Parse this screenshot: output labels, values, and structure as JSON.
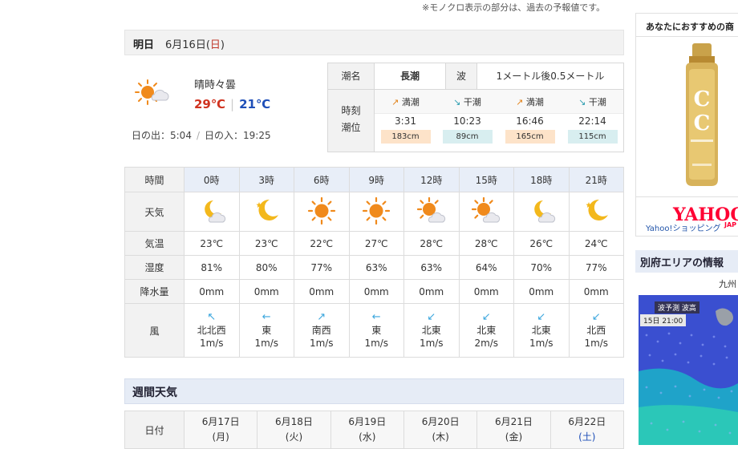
{
  "note": "※モノクロ表示の部分は、過去の予報値です。",
  "day": {
    "label": "明日",
    "date": "6月16日",
    "dow_open": "(",
    "dow": "日",
    "dow_close": ")"
  },
  "summary": {
    "icon": "sun-cloud-icon",
    "telop": "晴時々曇",
    "max": "29℃",
    "min": "21℃",
    "sunrise": "日の出：5:04",
    "sunset": "日の入：19:25"
  },
  "tide": {
    "name_label": "潮名",
    "name": "長潮",
    "wave_label": "波",
    "wave": "1メートル後0.5メートル",
    "row_label_1": "時刻",
    "row_label_2": "潮位",
    "events": [
      {
        "arrow": "↗",
        "type": "満潮",
        "time": "3:31",
        "level": "183cm",
        "kind": "high"
      },
      {
        "arrow": "↘",
        "type": "干潮",
        "time": "10:23",
        "level": "89cm",
        "kind": "low"
      },
      {
        "arrow": "↗",
        "type": "満潮",
        "time": "16:46",
        "level": "165cm",
        "kind": "high"
      },
      {
        "arrow": "↘",
        "type": "干潮",
        "time": "22:14",
        "level": "115cm",
        "kind": "low"
      }
    ]
  },
  "hourly": {
    "labels": {
      "time": "時間",
      "weather": "天気",
      "temp": "気温",
      "humidity": "湿度",
      "precip": "降水量",
      "wind": "風"
    },
    "hours": [
      {
        "time": "0時",
        "icon": "moon-cloud-icon",
        "temp": "23℃",
        "humidity": "81%",
        "precip": "0mm",
        "wind_arrow": "↖",
        "wind_dir": "北北西",
        "wind_speed": "1m/s"
      },
      {
        "time": "3時",
        "icon": "moon-icon",
        "temp": "23℃",
        "humidity": "80%",
        "precip": "0mm",
        "wind_arrow": "←",
        "wind_dir": "東",
        "wind_speed": "1m/s"
      },
      {
        "time": "6時",
        "icon": "sun-icon",
        "temp": "22℃",
        "humidity": "77%",
        "precip": "0mm",
        "wind_arrow": "↗",
        "wind_dir": "南西",
        "wind_speed": "1m/s"
      },
      {
        "time": "9時",
        "icon": "sun-icon",
        "temp": "27℃",
        "humidity": "63%",
        "precip": "0mm",
        "wind_arrow": "←",
        "wind_dir": "東",
        "wind_speed": "1m/s"
      },
      {
        "time": "12時",
        "icon": "sun-cloud-icon",
        "temp": "28℃",
        "humidity": "63%",
        "precip": "0mm",
        "wind_arrow": "↙",
        "wind_dir": "北東",
        "wind_speed": "1m/s"
      },
      {
        "time": "15時",
        "icon": "sun-cloud-icon",
        "temp": "28℃",
        "humidity": "64%",
        "precip": "0mm",
        "wind_arrow": "↙",
        "wind_dir": "北東",
        "wind_speed": "2m/s"
      },
      {
        "time": "18時",
        "icon": "moon-cloud-icon",
        "temp": "26℃",
        "humidity": "70%",
        "precip": "0mm",
        "wind_arrow": "↙",
        "wind_dir": "北東",
        "wind_speed": "1m/s"
      },
      {
        "time": "21時",
        "icon": "moon-icon",
        "temp": "24℃",
        "humidity": "77%",
        "precip": "0mm",
        "wind_arrow": "↙",
        "wind_dir": "北西",
        "wind_speed": "1m/s"
      }
    ]
  },
  "weekly": {
    "title": "週間天気",
    "row_label": "日付",
    "days": [
      {
        "date": "6月17日",
        "dow": "(月)",
        "sat": false
      },
      {
        "date": "6月18日",
        "dow": "(火)",
        "sat": false
      },
      {
        "date": "6月19日",
        "dow": "(水)",
        "sat": false
      },
      {
        "date": "6月20日",
        "dow": "(木)",
        "sat": false
      },
      {
        "date": "6月21日",
        "dow": "(金)",
        "sat": false
      },
      {
        "date": "6月22日",
        "dow": "(土)",
        "sat": true
      }
    ]
  },
  "sidebar": {
    "ad_title": "あなたにおすすめの商",
    "ad_logo": "YAHOO",
    "ad_logo_sub": "JAP",
    "ad_shop": "Yahoo!ショッピング",
    "area_title": "別府エリアの情報",
    "area_sub": "九州",
    "map_label": "波予測 波高",
    "map_time": "15日 21:00"
  },
  "colors": {
    "max_temp": "#d0321f",
    "min_temp": "#1f4fb8",
    "sun": "#f08a1c",
    "moon": "#f3b81c",
    "wind": "#3aa6dd"
  }
}
